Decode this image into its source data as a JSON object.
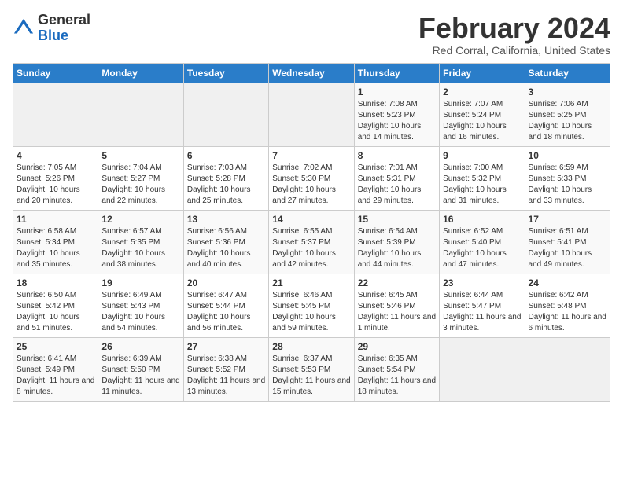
{
  "header": {
    "logo_line1": "General",
    "logo_line2": "Blue",
    "month_title": "February 2024",
    "location": "Red Corral, California, United States"
  },
  "days_of_week": [
    "Sunday",
    "Monday",
    "Tuesday",
    "Wednesday",
    "Thursday",
    "Friday",
    "Saturday"
  ],
  "weeks": [
    [
      {
        "day": "",
        "info": ""
      },
      {
        "day": "",
        "info": ""
      },
      {
        "day": "",
        "info": ""
      },
      {
        "day": "",
        "info": ""
      },
      {
        "day": "1",
        "info": "Sunrise: 7:08 AM\nSunset: 5:23 PM\nDaylight: 10 hours\nand 14 minutes."
      },
      {
        "day": "2",
        "info": "Sunrise: 7:07 AM\nSunset: 5:24 PM\nDaylight: 10 hours\nand 16 minutes."
      },
      {
        "day": "3",
        "info": "Sunrise: 7:06 AM\nSunset: 5:25 PM\nDaylight: 10 hours\nand 18 minutes."
      }
    ],
    [
      {
        "day": "4",
        "info": "Sunrise: 7:05 AM\nSunset: 5:26 PM\nDaylight: 10 hours\nand 20 minutes."
      },
      {
        "day": "5",
        "info": "Sunrise: 7:04 AM\nSunset: 5:27 PM\nDaylight: 10 hours\nand 22 minutes."
      },
      {
        "day": "6",
        "info": "Sunrise: 7:03 AM\nSunset: 5:28 PM\nDaylight: 10 hours\nand 25 minutes."
      },
      {
        "day": "7",
        "info": "Sunrise: 7:02 AM\nSunset: 5:30 PM\nDaylight: 10 hours\nand 27 minutes."
      },
      {
        "day": "8",
        "info": "Sunrise: 7:01 AM\nSunset: 5:31 PM\nDaylight: 10 hours\nand 29 minutes."
      },
      {
        "day": "9",
        "info": "Sunrise: 7:00 AM\nSunset: 5:32 PM\nDaylight: 10 hours\nand 31 minutes."
      },
      {
        "day": "10",
        "info": "Sunrise: 6:59 AM\nSunset: 5:33 PM\nDaylight: 10 hours\nand 33 minutes."
      }
    ],
    [
      {
        "day": "11",
        "info": "Sunrise: 6:58 AM\nSunset: 5:34 PM\nDaylight: 10 hours\nand 35 minutes."
      },
      {
        "day": "12",
        "info": "Sunrise: 6:57 AM\nSunset: 5:35 PM\nDaylight: 10 hours\nand 38 minutes."
      },
      {
        "day": "13",
        "info": "Sunrise: 6:56 AM\nSunset: 5:36 PM\nDaylight: 10 hours\nand 40 minutes."
      },
      {
        "day": "14",
        "info": "Sunrise: 6:55 AM\nSunset: 5:37 PM\nDaylight: 10 hours\nand 42 minutes."
      },
      {
        "day": "15",
        "info": "Sunrise: 6:54 AM\nSunset: 5:39 PM\nDaylight: 10 hours\nand 44 minutes."
      },
      {
        "day": "16",
        "info": "Sunrise: 6:52 AM\nSunset: 5:40 PM\nDaylight: 10 hours\nand 47 minutes."
      },
      {
        "day": "17",
        "info": "Sunrise: 6:51 AM\nSunset: 5:41 PM\nDaylight: 10 hours\nand 49 minutes."
      }
    ],
    [
      {
        "day": "18",
        "info": "Sunrise: 6:50 AM\nSunset: 5:42 PM\nDaylight: 10 hours\nand 51 minutes."
      },
      {
        "day": "19",
        "info": "Sunrise: 6:49 AM\nSunset: 5:43 PM\nDaylight: 10 hours\nand 54 minutes."
      },
      {
        "day": "20",
        "info": "Sunrise: 6:47 AM\nSunset: 5:44 PM\nDaylight: 10 hours\nand 56 minutes."
      },
      {
        "day": "21",
        "info": "Sunrise: 6:46 AM\nSunset: 5:45 PM\nDaylight: 10 hours\nand 59 minutes."
      },
      {
        "day": "22",
        "info": "Sunrise: 6:45 AM\nSunset: 5:46 PM\nDaylight: 11 hours\nand 1 minute."
      },
      {
        "day": "23",
        "info": "Sunrise: 6:44 AM\nSunset: 5:47 PM\nDaylight: 11 hours\nand 3 minutes."
      },
      {
        "day": "24",
        "info": "Sunrise: 6:42 AM\nSunset: 5:48 PM\nDaylight: 11 hours\nand 6 minutes."
      }
    ],
    [
      {
        "day": "25",
        "info": "Sunrise: 6:41 AM\nSunset: 5:49 PM\nDaylight: 11 hours\nand 8 minutes."
      },
      {
        "day": "26",
        "info": "Sunrise: 6:39 AM\nSunset: 5:50 PM\nDaylight: 11 hours\nand 11 minutes."
      },
      {
        "day": "27",
        "info": "Sunrise: 6:38 AM\nSunset: 5:52 PM\nDaylight: 11 hours\nand 13 minutes."
      },
      {
        "day": "28",
        "info": "Sunrise: 6:37 AM\nSunset: 5:53 PM\nDaylight: 11 hours\nand 15 minutes."
      },
      {
        "day": "29",
        "info": "Sunrise: 6:35 AM\nSunset: 5:54 PM\nDaylight: 11 hours\nand 18 minutes."
      },
      {
        "day": "",
        "info": ""
      },
      {
        "day": "",
        "info": ""
      }
    ]
  ]
}
